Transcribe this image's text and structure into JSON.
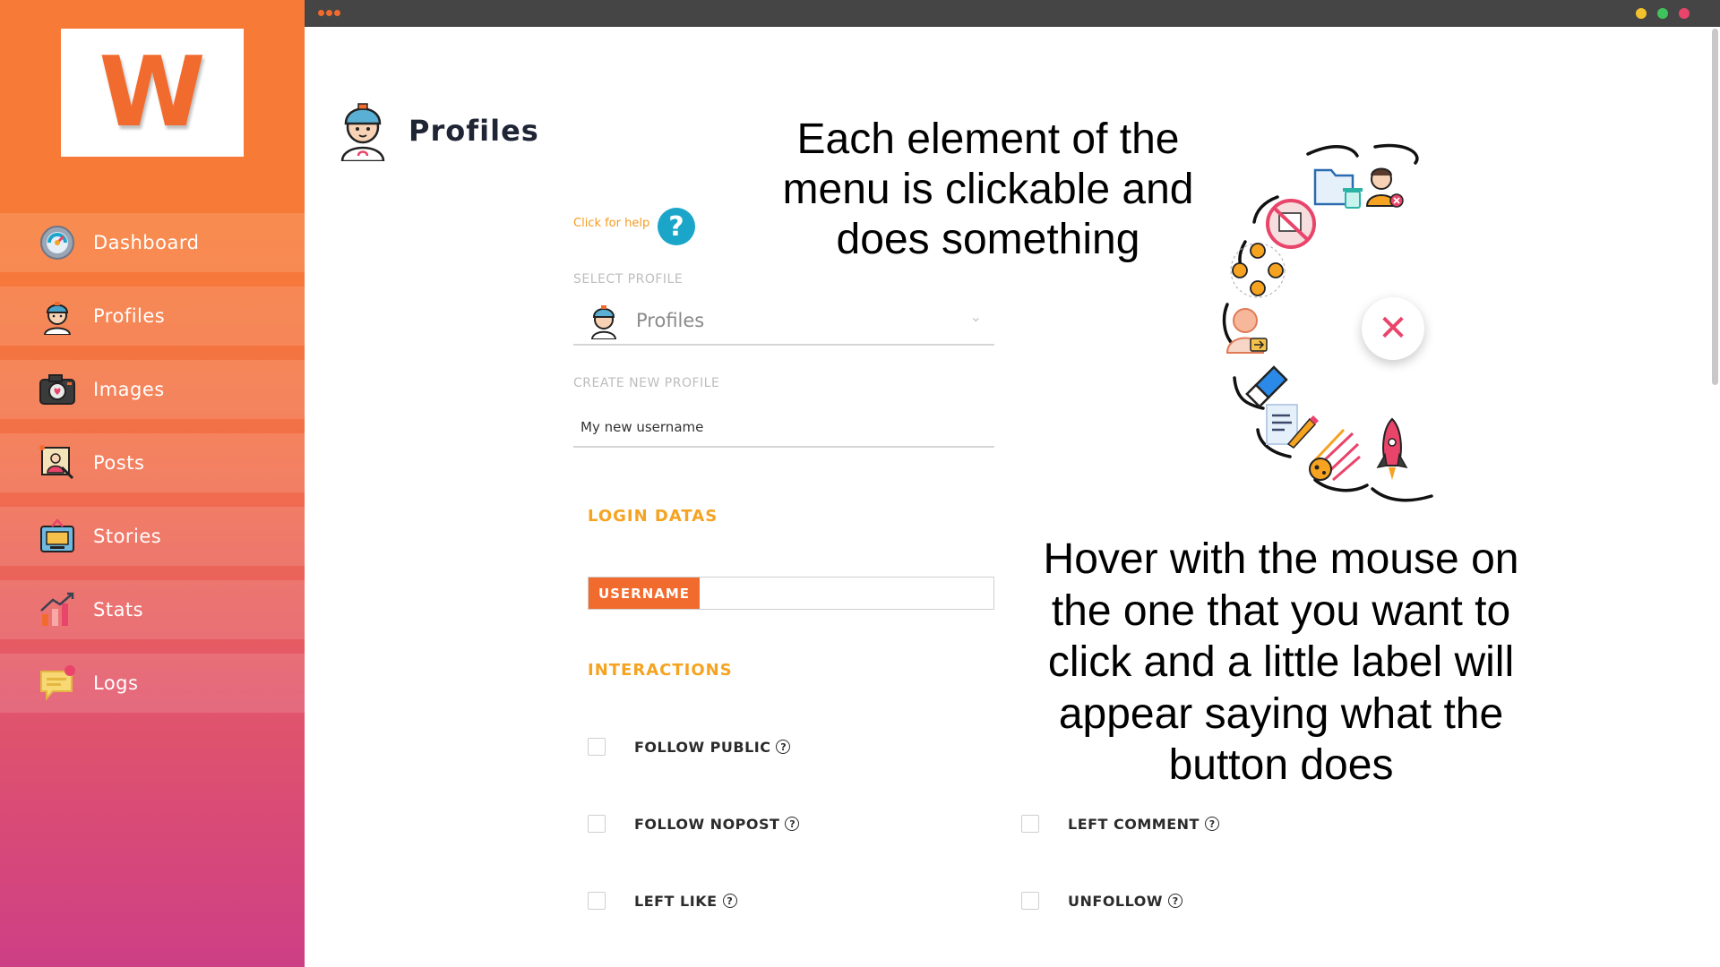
{
  "app": {
    "logo_letter": "W"
  },
  "sidebar": {
    "items": [
      {
        "label": "Dashboard",
        "icon": "dashboard-gauge-icon"
      },
      {
        "label": "Profiles",
        "icon": "profile-boy-icon"
      },
      {
        "label": "Images",
        "icon": "camera-icon"
      },
      {
        "label": "Posts",
        "icon": "posts-picture-icon"
      },
      {
        "label": "Stories",
        "icon": "stories-icon"
      },
      {
        "label": "Stats",
        "icon": "bar-chart-arrow-icon"
      },
      {
        "label": "Logs",
        "icon": "chat-bubble-icon"
      }
    ],
    "colors": {
      "top": "#f77b37",
      "bottom": "#cd3f85"
    }
  },
  "window": {
    "controls": [
      {
        "name": "minimize",
        "color": "#f2c12e"
      },
      {
        "name": "maximize",
        "color": "#3fc35c"
      },
      {
        "name": "close",
        "color": "#e9446a"
      }
    ]
  },
  "header": {
    "title": "Profiles",
    "icon": "profile-boy-icon"
  },
  "help": {
    "link_text": "Click for help",
    "button_glyph": "?"
  },
  "select_profile": {
    "label": "SELECT PROFILE",
    "value": "Profiles"
  },
  "create_profile": {
    "label": "CREATE NEW PROFILE",
    "placeholder": "My new username"
  },
  "login": {
    "section_title": "LOGIN DATAS",
    "username_addon": "USERNAME",
    "username_value": ""
  },
  "interactions": {
    "section_title": "INTERACTIONS",
    "items": [
      {
        "label": "FOLLOW PUBLIC",
        "checked": false
      },
      {
        "label": "FOLLOW NOPOST",
        "checked": false
      },
      {
        "label": "LEFT COMMENT",
        "checked": false
      },
      {
        "label": "LEFT LIKE",
        "checked": false
      },
      {
        "label": "UNFOLLOW",
        "checked": false
      }
    ]
  },
  "callouts": {
    "top": "Each element of the menu is clickable and does something",
    "bottom": "Hover with the mouse on the one that you want to click and a little label will appear saying what the button does"
  },
  "radial_menu": {
    "items": [
      {
        "icon": "folder-delete-icon"
      },
      {
        "icon": "user-remove-icon"
      },
      {
        "icon": "no-images-icon"
      },
      {
        "icon": "network-users-icon"
      },
      {
        "icon": "user-export-icon"
      },
      {
        "icon": "eraser-icon"
      },
      {
        "icon": "document-edit-icon"
      },
      {
        "icon": "meteor-icon"
      },
      {
        "icon": "rocket-icon"
      }
    ],
    "close_glyph": "✕"
  },
  "accent_colors": {
    "orange": "#f26b2e",
    "gold": "#f5a320",
    "help_blue": "#1ba6c9",
    "close_pink": "#e9446a"
  }
}
